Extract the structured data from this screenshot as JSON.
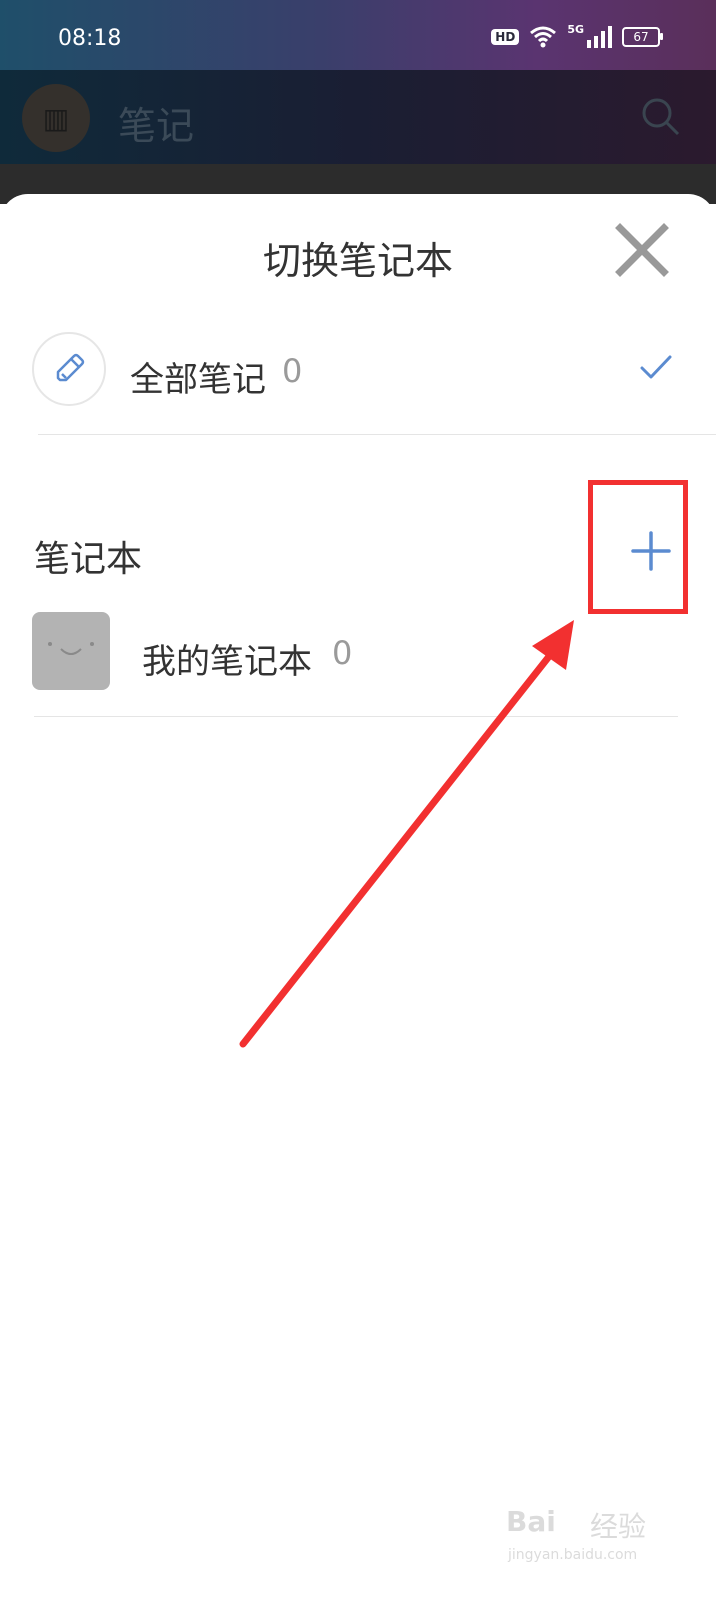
{
  "status_bar": {
    "time": "08:18",
    "hd_badge": "HD",
    "network": "5G",
    "battery": "67"
  },
  "app_header": {
    "title": "笔记",
    "icons": [
      "app-logo",
      "search-icon"
    ]
  },
  "sheet": {
    "title": "切换笔记本",
    "close_icon": "close-icon",
    "all_notes": {
      "label": "全部笔记",
      "count": "0",
      "selected": true
    },
    "notebooks_section": {
      "title": "笔记本",
      "add_icon": "plus-icon"
    },
    "notebooks": [
      {
        "label": "我的笔记本",
        "count": "0"
      }
    ]
  },
  "annotation": {
    "highlight_color": "#f23030"
  },
  "colors": {
    "accent": "#5b8bd0",
    "text": "#333333",
    "muted": "#9a9a9a"
  },
  "watermark": {
    "brand": "Bai",
    "cn": "经验",
    "url": "jingyan.baidu.com"
  }
}
